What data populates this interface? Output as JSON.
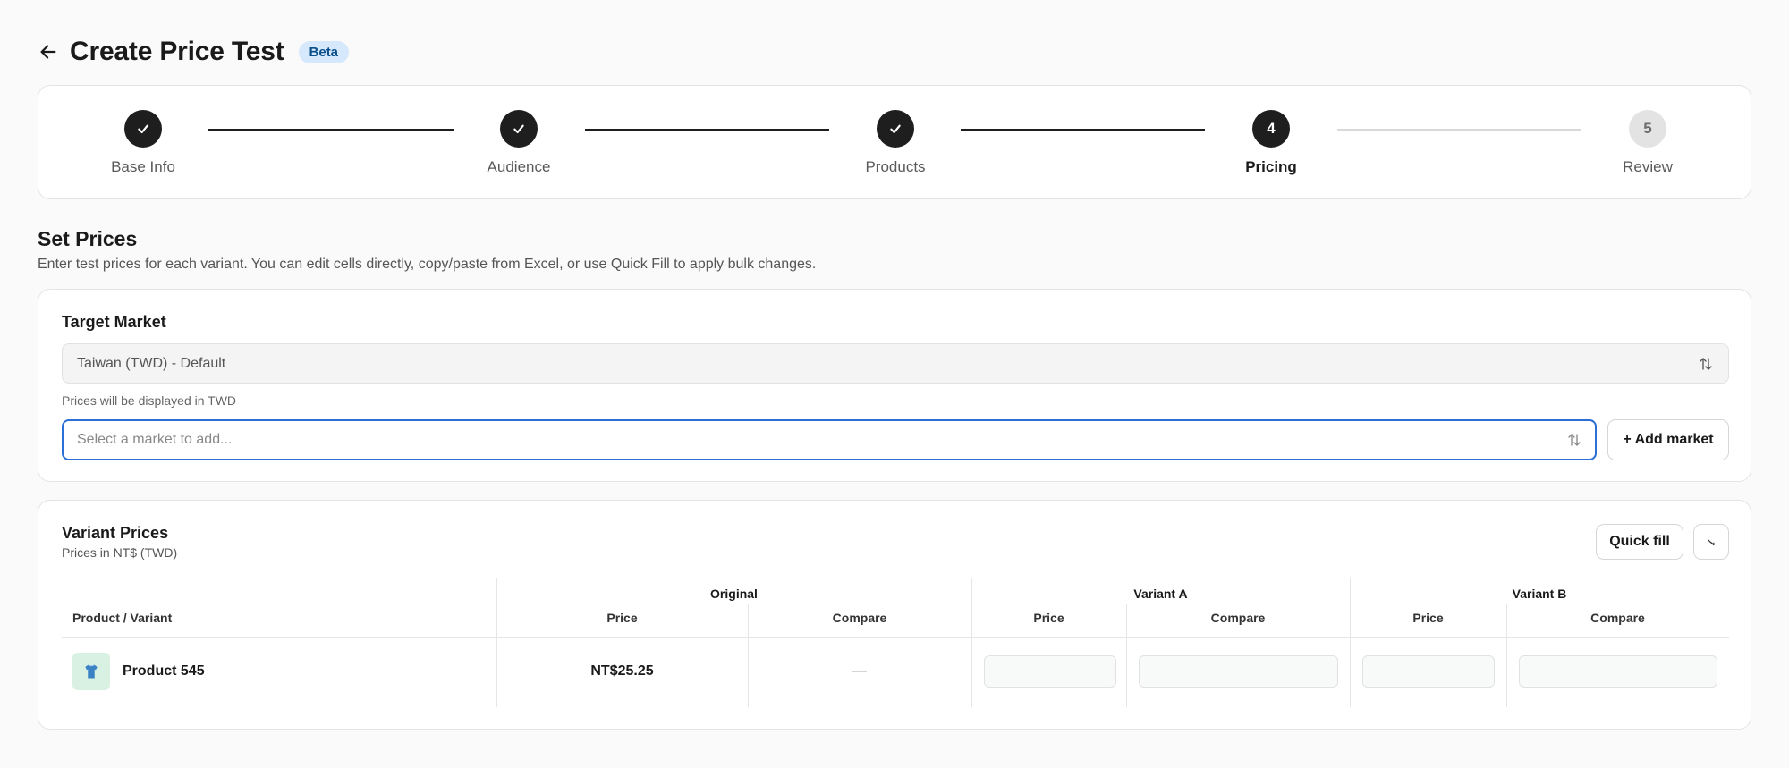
{
  "header": {
    "title": "Create Price Test",
    "badge": "Beta"
  },
  "stepper": {
    "steps": [
      {
        "label": "Base Info",
        "state": "done",
        "number": "1"
      },
      {
        "label": "Audience",
        "state": "done",
        "number": "2"
      },
      {
        "label": "Products",
        "state": "done",
        "number": "3"
      },
      {
        "label": "Pricing",
        "state": "current",
        "number": "4"
      },
      {
        "label": "Review",
        "state": "todo",
        "number": "5"
      }
    ]
  },
  "section": {
    "title": "Set Prices",
    "description": "Enter test prices for each variant. You can edit cells directly, copy/paste from Excel, or use Quick Fill to apply bulk changes."
  },
  "target_market": {
    "title": "Target Market",
    "selected_value": "Taiwan (TWD) - Default",
    "hint": "Prices will be displayed in TWD",
    "add_placeholder": "Select a market to add...",
    "add_button": "+ Add market"
  },
  "variant_prices": {
    "title": "Variant Prices",
    "subtitle": "Prices in NT$ (TWD)",
    "quick_fill_label": "Quick fill",
    "columns": {
      "product": "Product / Variant",
      "groups": [
        "Original",
        "Variant A",
        "Variant B"
      ],
      "price": "Price",
      "compare": "Compare"
    },
    "rows": [
      {
        "product": "Product 545",
        "original_price": "NT$25.25",
        "original_compare": "—",
        "variant_a_price": "",
        "variant_a_compare": "",
        "variant_b_price": "",
        "variant_b_compare": ""
      }
    ]
  },
  "icons": {
    "back": "arrow-left-icon",
    "check": "check-icon",
    "sort": "sort-arrows-icon",
    "expand": "expand-icon",
    "product": "shirt-icon"
  },
  "colors": {
    "accent": "#2c6fd6",
    "step_done": "#1e1e1e",
    "badge_bg": "#d6e8fb",
    "badge_text": "#0b4f8a",
    "product_thumb_bg": "#d9f1e3"
  }
}
